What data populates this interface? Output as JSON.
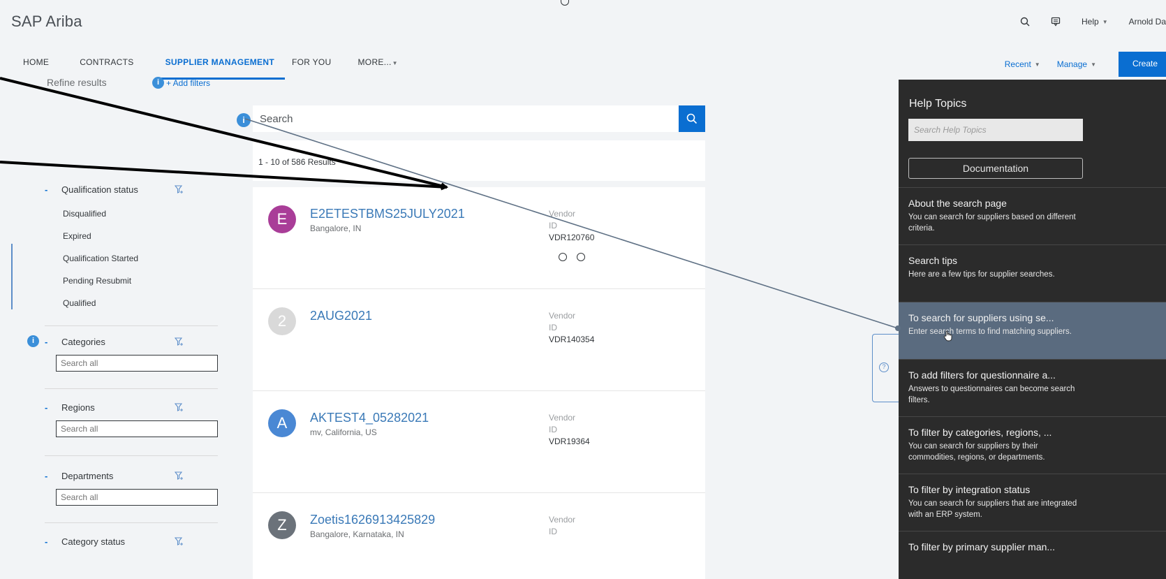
{
  "header": {
    "brand": "SAP Ariba",
    "help_label": "Help",
    "user_name": "Arnold Da"
  },
  "nav": {
    "tabs": [
      "HOME",
      "CONTRACTS",
      "SUPPLIER MANAGEMENT",
      "FOR YOU",
      "MORE..."
    ],
    "active_tab": "SUPPLIER MANAGEMENT",
    "recent_label": "Recent",
    "manage_label": "Manage",
    "create_label": "Create"
  },
  "filters": {
    "refine_title": "Refine results",
    "add_filters_label": "+ Add filters",
    "qualification": {
      "title": "Qualification status",
      "options": [
        "Disqualified",
        "Expired",
        "Qualification Started",
        "Pending Resubmit",
        "Qualified"
      ]
    },
    "categories": {
      "title": "Categories",
      "placeholder": "Search all"
    },
    "regions": {
      "title": "Regions",
      "placeholder": "Search all"
    },
    "departments": {
      "title": "Departments",
      "placeholder": "Search all"
    },
    "category_status": {
      "title": "Category status"
    }
  },
  "search": {
    "placeholder": "Search",
    "results_count": "1 - 10 of 586 Results"
  },
  "results": [
    {
      "initial": "E",
      "color": "#a93d98",
      "name": "E2ETESTBMS25JULY2021",
      "location": "Bangalore, IN",
      "vendor_label": "Vendor",
      "id_label": "ID",
      "vendor_id": "VDR120760"
    },
    {
      "initial": "2",
      "color": "#d9d9d9",
      "name": "2AUG2021",
      "location": "",
      "vendor_label": "Vendor",
      "id_label": "ID",
      "vendor_id": "VDR140354"
    },
    {
      "initial": "A",
      "color": "#4a88d4",
      "name": "AKTEST4_05282021",
      "location": "mv, California, US",
      "vendor_label": "Vendor",
      "id_label": "ID",
      "vendor_id": "VDR19364"
    },
    {
      "initial": "Z",
      "color": "#6b727a",
      "name": "Zoetis1626913425829",
      "location": "Bangalore, Karnataka, IN",
      "vendor_label": "Vendor",
      "id_label": "ID",
      "vendor_id": ""
    }
  ],
  "help_panel": {
    "title": "Help Topics",
    "search_placeholder": "Search Help Topics",
    "documentation_label": "Documentation",
    "topics": [
      {
        "title": "About the search page",
        "desc": "You can search for suppliers based on different criteria."
      },
      {
        "title": "Search tips",
        "desc": "Here are a few tips for supplier searches."
      },
      {
        "title": "To search for suppliers using se...",
        "desc": "Enter search terms to find matching suppliers."
      },
      {
        "title": "To add filters for questionnaire a...",
        "desc": "Answers to questionnaires can become search filters."
      },
      {
        "title": "To filter by categories, regions, ...",
        "desc": "You can search for suppliers by their commodities, regions, or departments."
      },
      {
        "title": "To filter by integration status",
        "desc": "You can search for suppliers that are integrated with an ERP system."
      },
      {
        "title": "To filter by primary supplier man...",
        "desc": ""
      }
    ],
    "active_topic": "To search for suppliers using se..."
  },
  "colors": {
    "accent": "#0a6ed1",
    "help_bg": "#2b2b2b",
    "help_active": "#5a6b7f"
  }
}
